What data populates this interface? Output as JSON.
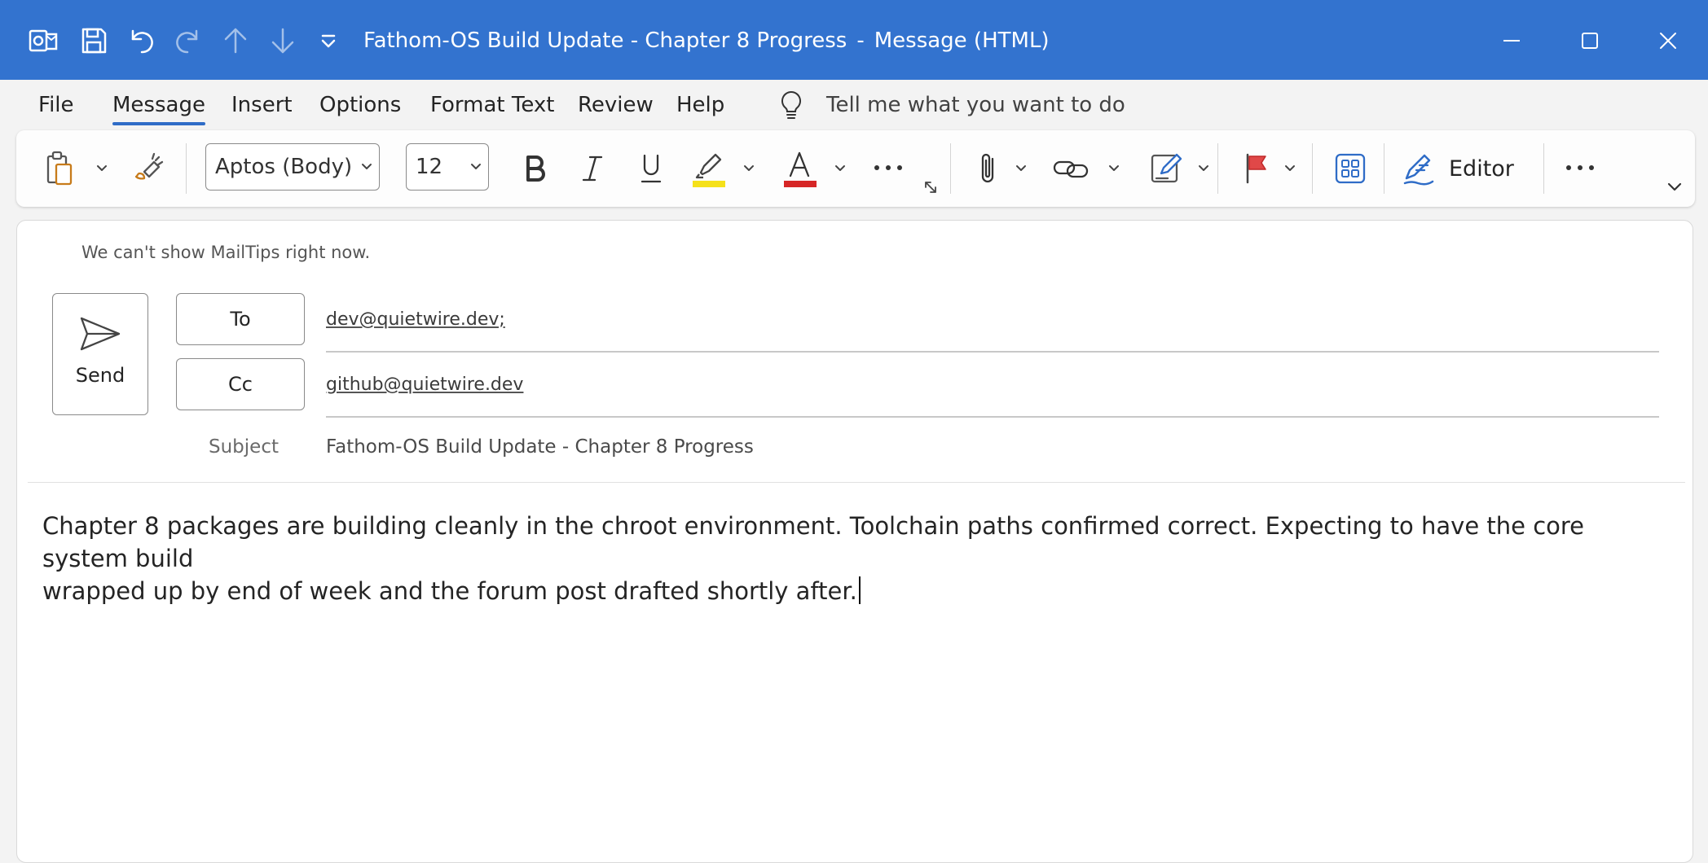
{
  "window": {
    "title": "Fathom-OS Build Update - Chapter 8 Progress",
    "title_separator": "-",
    "title_mode": "Message (HTML)",
    "accent_color": "#3373cf"
  },
  "quick_access": {
    "icons": [
      "outlook-icon",
      "save-icon",
      "undo-icon",
      "redo-icon",
      "up-arrow-icon",
      "down-arrow-icon",
      "customize-dropdown-icon"
    ]
  },
  "menu": {
    "items": [
      "File",
      "Message",
      "Insert",
      "Options",
      "Format Text",
      "Review",
      "Help"
    ],
    "active": "Message",
    "tell_me": "Tell me what you want to do"
  },
  "ribbon": {
    "font_name": "Aptos (Body)",
    "font_size": "12",
    "editor_label": "Editor",
    "highlight_color": "#f5e11a",
    "font_color": "#d62626"
  },
  "compose": {
    "mailtips": "We can't show MailTips right now.",
    "send_label": "Send",
    "to_label": "To",
    "to_value": "dev@quietwire.dev;",
    "cc_label": "Cc",
    "cc_value": "github@quietwire.dev",
    "subject_label": "Subject",
    "subject_value": "Fathom-OS Build Update - Chapter 8 Progress",
    "body_line1": "Chapter 8 packages are building cleanly in the chroot environment. Toolchain paths confirmed correct. Expecting to have the core system build",
    "body_line2": "wrapped up by end of week and the forum post drafted shortly after."
  }
}
